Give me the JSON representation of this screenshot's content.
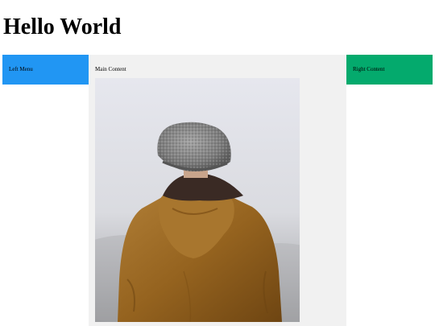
{
  "page": {
    "title": "Hello World"
  },
  "left_menu": {
    "label": "Left Menu"
  },
  "main": {
    "label": "Main Content",
    "image": {
      "subject": "person-in-beanie-and-hooded-jacket"
    }
  },
  "right": {
    "label": "Right Content"
  },
  "colors": {
    "left_menu_bg": "#2196F3",
    "main_bg": "#f1f1f1",
    "right_bg": "#04AA6D"
  }
}
